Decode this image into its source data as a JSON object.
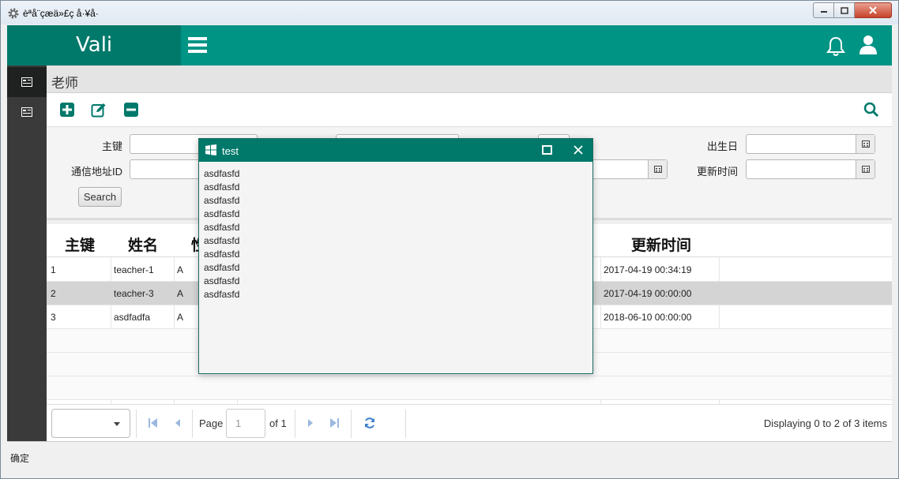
{
  "window": {
    "title": "èªå¨çæä»£ç å·¥å·"
  },
  "header": {
    "brand": "Vali"
  },
  "page": {
    "title": "老师"
  },
  "form": {
    "fields": [
      {
        "label": "主键",
        "value": ""
      },
      {
        "label": "通信地址ID",
        "value": ""
      },
      {
        "label": "出生日",
        "value": ""
      },
      {
        "label": "更新时间",
        "value": ""
      }
    ],
    "search_label": "Search"
  },
  "grid": {
    "headers": [
      "主键",
      "姓名",
      "性",
      "更新时间"
    ],
    "rows": [
      {
        "id": "1",
        "name": "teacher-1",
        "sex": "A",
        "updated": "2017-04-19 00:34:19"
      },
      {
        "id": "2",
        "name": "teacher-3",
        "sex": "A",
        "updated": "2017-04-19 00:00:00"
      },
      {
        "id": "3",
        "name": "asdfadfa",
        "sex": "A",
        "updated": "2018-06-10 00:00:00"
      }
    ]
  },
  "pager": {
    "page_label": "Page",
    "page_value": "1",
    "of_label": "of 1",
    "info": "Displaying 0 to 2 of 3 items"
  },
  "status": {
    "text": "确定"
  },
  "dialog": {
    "title": "test",
    "lines": [
      "asdfasfd",
      "asdfasfd",
      "asdfasfd",
      "asdfasfd",
      "asdfasfd",
      "asdfasfd",
      "asdfasfd",
      "asdfasfd",
      "asdfasfd",
      "asdfasfd"
    ]
  },
  "colors": {
    "brand": "#009485",
    "brand_dark": "#00796b",
    "sidebar": "#3a3a3a"
  }
}
